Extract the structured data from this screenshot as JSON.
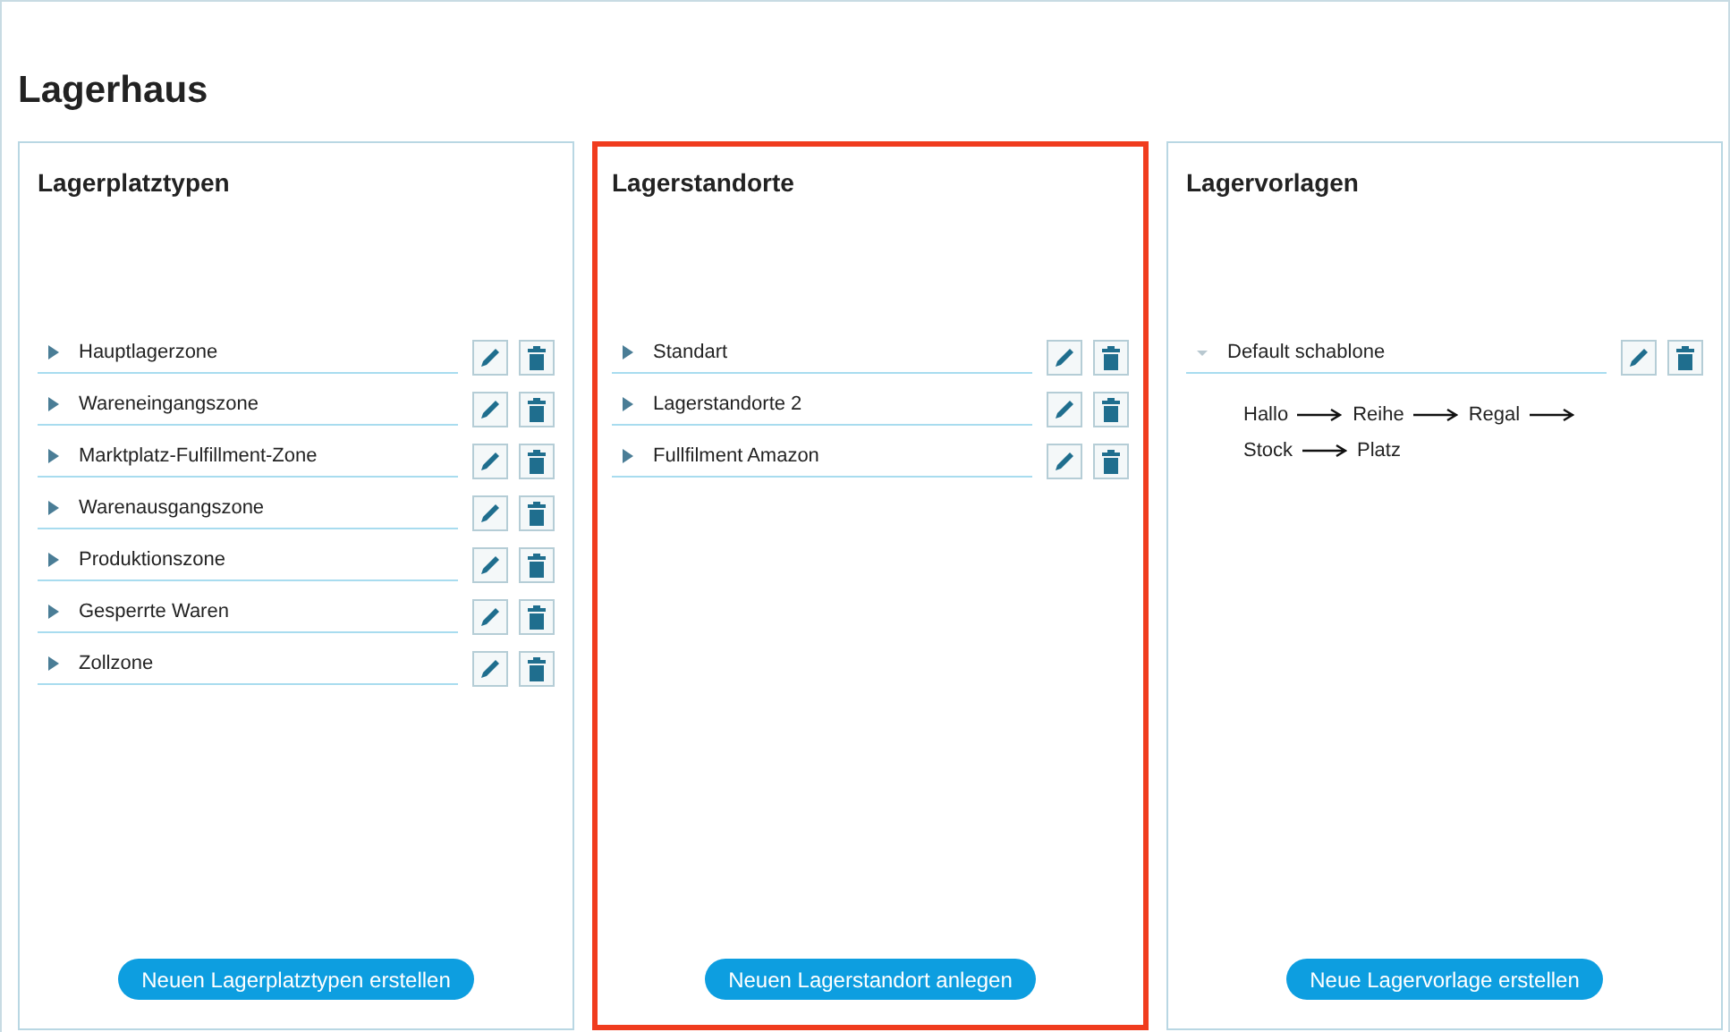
{
  "title": "Lagerhaus",
  "panels": [
    {
      "title": "Lagerplatztypen",
      "highlighted": false,
      "items": [
        {
          "label": "Hauptlagerzone",
          "expanded": false
        },
        {
          "label": "Wareneingangszone",
          "expanded": false
        },
        {
          "label": "Marktplatz-Fulfillment-Zone",
          "expanded": false
        },
        {
          "label": "Warenausgangszone",
          "expanded": false
        },
        {
          "label": "Produktionszone",
          "expanded": false
        },
        {
          "label": "Gesperrte Waren",
          "expanded": false
        },
        {
          "label": "Zollzone",
          "expanded": false
        }
      ],
      "button": "Neuen Lagerplatztypen erstellen"
    },
    {
      "title": "Lagerstandorte",
      "highlighted": true,
      "items": [
        {
          "label": "Standart",
          "expanded": false
        },
        {
          "label": "Lagerstandorte 2",
          "expanded": false
        },
        {
          "label": "Fullfilment Amazon",
          "expanded": false
        }
      ],
      "button": "Neuen Lagerstandort anlegen"
    },
    {
      "title": "Lagervorlagen",
      "highlighted": false,
      "items": [
        {
          "label": "Default schablone",
          "expanded": true,
          "path": [
            "Hallo",
            "Reihe",
            "Regal",
            "Stock",
            "Platz"
          ]
        }
      ],
      "button": "Neue Lagervorlage erstellen"
    }
  ]
}
